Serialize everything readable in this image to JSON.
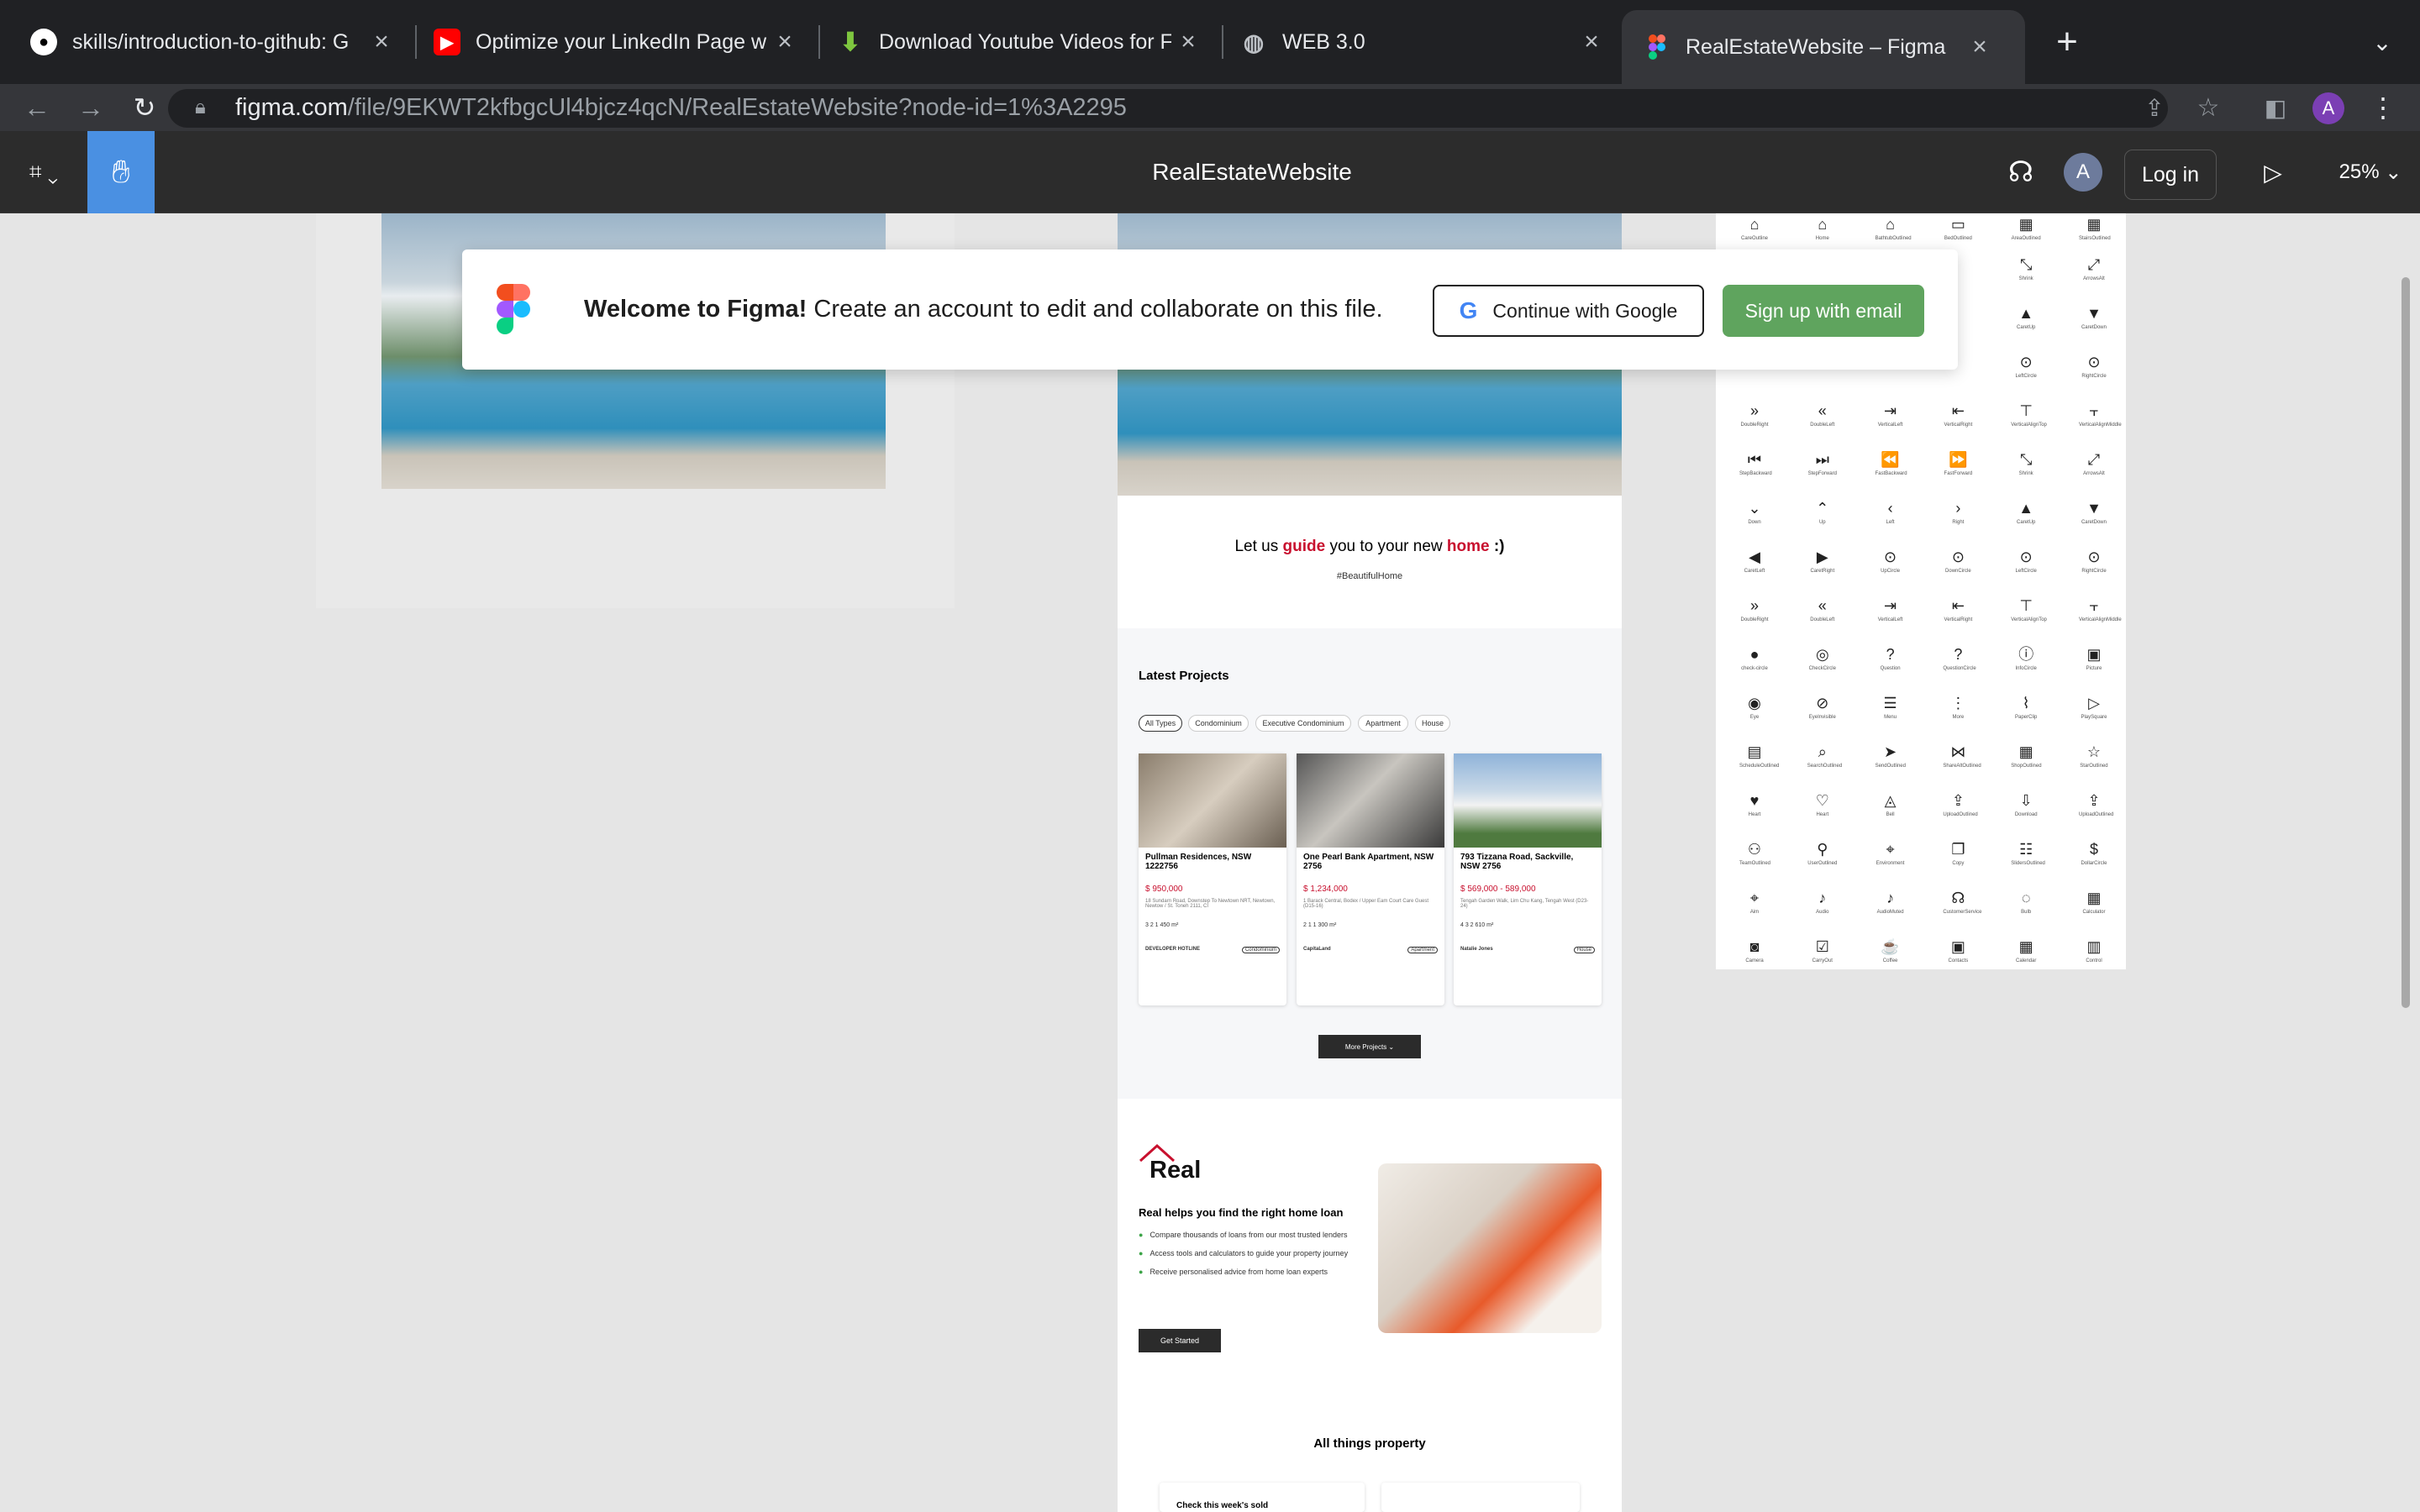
{
  "browser": {
    "tabs": [
      {
        "title": "skills/introduction-to-github: G",
        "icon": "github-icon"
      },
      {
        "title": "Optimize your LinkedIn Page w",
        "icon": "youtube-icon"
      },
      {
        "title": "Download Youtube Videos for F",
        "icon": "download-icon"
      },
      {
        "title": "WEB 3.0",
        "icon": "globe-icon"
      },
      {
        "title": "RealEstateWebsite – Figma",
        "icon": "figma-icon"
      }
    ],
    "url_host": "figma.com",
    "url_path": "/file/9EKWT2kfbgcUl4bjcz4qcN/RealEstateWebsite?node-id=1%3A2295",
    "profile_initial": "A"
  },
  "figma": {
    "file_name": "RealEstateWebsite",
    "avatar_initial": "A",
    "login_label": "Log in",
    "zoom": "25%"
  },
  "banner": {
    "welcome_bold": "Welcome to Figma!",
    "welcome_text": "Create an account to edit and collaborate on this file.",
    "google_label": "Continue with Google",
    "email_label": "Sign up with email"
  },
  "site": {
    "tagline_pre": "Let us",
    "tagline_guide": "guide",
    "tagline_mid": "you to your new",
    "tagline_home": "home",
    "tagline_end": ":)",
    "hashtag": "#BeautifulHome",
    "latest_title": "Latest Projects",
    "filters": [
      "All Types",
      "Condominium",
      "Executive Condominium",
      "Apartment",
      "House"
    ],
    "cards": [
      {
        "title": "Pullman Residences, NSW 1222756",
        "price": "$ 950,000",
        "addr": "18 Sundarn Road, Downstep To Newtown NRT, Newtown, Newtow / St. Toneh 2111, CI",
        "stats": "3  2  1  450 m²",
        "agent": "DEVELOPER HOTLINE",
        "tag": "Condominium"
      },
      {
        "title": "One Pearl Bank Apartment, NSW 2756",
        "price": "$ 1,234,000",
        "addr": "1 Barack Central, Bodex / Upper Eam Court Care Guest (D15-16)",
        "stats": "2  1  1  300 m²",
        "agent": "CapitaLand",
        "tag": "Apartment"
      },
      {
        "title": "793 Tizzana Road, Sackville, NSW 2756",
        "price": "$ 569,000 - 589,000",
        "addr": "Tengah Garden Walk, Lim Chu Kang, Tengah West (D23-24)",
        "stats": "4  3  2  610 m²",
        "agent": "Natalie Jones",
        "tag": "House"
      }
    ],
    "more_label": "More Projects",
    "brand": "Real",
    "loan_title": "Real helps you find the right home loan",
    "bullets": [
      "Compare thousands of loans from our most trusted lenders",
      "Access tools and calculators to guide your property journey",
      "Receive personalised advice from home loan experts"
    ],
    "cta": "Get Started",
    "all_things": "All things property",
    "check_sold": "Check this week's sold"
  },
  "icon_sheet": {
    "rows": [
      [
        [
          "⌂",
          "CareOutline"
        ],
        [
          "⌂",
          "Home"
        ],
        [
          "⌂",
          "BathtubOutlined"
        ],
        [
          "▭",
          "BedOutlined"
        ],
        [
          "▦",
          "AreaOutlined"
        ],
        [
          "▦",
          "StairsOutlined"
        ]
      ],
      [
        [
          "",
          ""
        ],
        [
          "",
          ""
        ],
        [
          "",
          ""
        ],
        [
          "",
          ""
        ],
        [
          "⤡",
          "Shrink"
        ],
        [
          "⤢",
          "ArrowsAlt"
        ]
      ],
      [
        [
          "",
          ""
        ],
        [
          "",
          ""
        ],
        [
          "",
          ""
        ],
        [
          "",
          ""
        ],
        [
          "▲",
          "CaretUp"
        ],
        [
          "▼",
          "CaretDown"
        ]
      ],
      [
        [
          "",
          ""
        ],
        [
          "",
          ""
        ],
        [
          "",
          ""
        ],
        [
          "",
          ""
        ],
        [
          "⊙",
          "LeftCircle"
        ],
        [
          "⊙",
          "RightCircle"
        ]
      ],
      [
        [
          "»",
          "DoubleRight"
        ],
        [
          "«",
          "DoubleLeft"
        ],
        [
          "⇥",
          "VerticalLeft"
        ],
        [
          "⇤",
          "VerticalRight"
        ],
        [
          "⊤",
          "VerticalAlignTop"
        ],
        [
          "⫟",
          "VerticalAlignMiddle"
        ]
      ],
      [
        [
          "⏮",
          "StepBackward"
        ],
        [
          "⏭",
          "StepForward"
        ],
        [
          "⏪",
          "FastBackward"
        ],
        [
          "⏩",
          "FastForward"
        ],
        [
          "⤡",
          "Shrink"
        ],
        [
          "⤢",
          "ArrowsAlt"
        ]
      ],
      [
        [
          "⌄",
          "Down"
        ],
        [
          "⌃",
          "Up"
        ],
        [
          "‹",
          "Left"
        ],
        [
          "›",
          "Right"
        ],
        [
          "▲",
          "CaretUp"
        ],
        [
          "▼",
          "CaretDown"
        ]
      ],
      [
        [
          "◀",
          "CaretLeft"
        ],
        [
          "▶",
          "CaretRight"
        ],
        [
          "⊙",
          "UpCircle"
        ],
        [
          "⊙",
          "DownCircle"
        ],
        [
          "⊙",
          "LeftCircle"
        ],
        [
          "⊙",
          "RightCircle"
        ]
      ],
      [
        [
          "»",
          "DoubleRight"
        ],
        [
          "«",
          "DoubleLeft"
        ],
        [
          "⇥",
          "VerticalLeft"
        ],
        [
          "⇤",
          "VerticalRight"
        ],
        [
          "⊤",
          "VerticalAlignTop"
        ],
        [
          "⫟",
          "VerticalAlignMiddle"
        ]
      ],
      [
        [
          "●",
          "check-circle"
        ],
        [
          "◎",
          "CheckCircle"
        ],
        [
          "?",
          "Question"
        ],
        [
          "?",
          "QuestionCircle"
        ],
        [
          "ⓘ",
          "InfoCircle"
        ],
        [
          "▣",
          "Picture"
        ]
      ],
      [
        [
          "◉",
          "Eye"
        ],
        [
          "⊘",
          "EyeInvisible"
        ],
        [
          "☰",
          "Menu"
        ],
        [
          "⋮",
          "More"
        ],
        [
          "⌇",
          "PaperClip"
        ],
        [
          "▷",
          "PlaySquare"
        ]
      ],
      [
        [
          "▤",
          "ScheduleOutlined"
        ],
        [
          "⌕",
          "SearchOutlined"
        ],
        [
          "➤",
          "SendOutlined"
        ],
        [
          "⋈",
          "ShareAltOutlined"
        ],
        [
          "▦",
          "ShopOutlined"
        ],
        [
          "☆",
          "StarOutlined"
        ]
      ],
      [
        [
          "♥",
          "Heart"
        ],
        [
          "♡",
          "Heart"
        ],
        [
          "◬",
          "Bell"
        ],
        [
          "⇪",
          "UploadOutlined"
        ],
        [
          "⇩",
          "Download"
        ],
        [
          "⇪",
          "UploadOutlined"
        ]
      ],
      [
        [
          "⚇",
          "TeamOutlined"
        ],
        [
          "⚲",
          "UserOutlined"
        ],
        [
          "⌖",
          "Environment"
        ],
        [
          "❐",
          "Copy"
        ],
        [
          "☷",
          "SlidersOutlined"
        ],
        [
          "$",
          "DollarCircle"
        ]
      ],
      [
        [
          "⌖",
          "Aim"
        ],
        [
          "♪",
          "Audio"
        ],
        [
          "♪",
          "AudioMuted"
        ],
        [
          "☊",
          "CustomerService"
        ],
        [
          "◌",
          "Bulb"
        ],
        [
          "▦",
          "Calculator"
        ]
      ],
      [
        [
          "◙",
          "Camera"
        ],
        [
          "☑",
          "CarryOut"
        ],
        [
          "☕",
          "Coffee"
        ],
        [
          "▣",
          "Contacts"
        ],
        [
          "▦",
          "Calendar"
        ],
        [
          "▥",
          "Control"
        ]
      ]
    ]
  }
}
